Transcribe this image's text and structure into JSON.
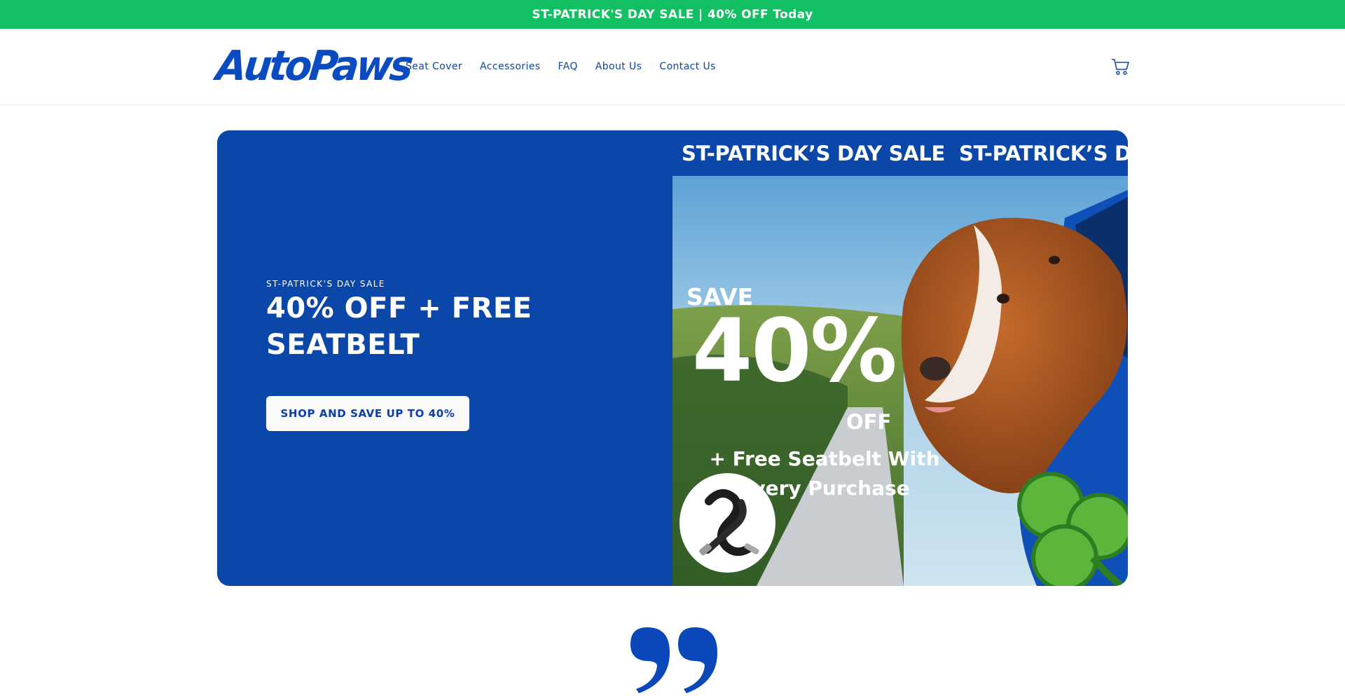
{
  "announcement": {
    "text": "ST-PATRICK'S DAY SALE | 40% OFF Today",
    "bg": "#12bf62"
  },
  "header": {
    "logo_text": "AutoPaws",
    "nav": [
      "Seat Cover",
      "Accessories",
      "FAQ",
      "About Us",
      "Contact Us"
    ],
    "cart_icon": "cart-icon"
  },
  "hero": {
    "eyebrow": "ST-PATRICK’S DAY SALE",
    "headline": "40% OFF + FREE SEATBELT",
    "cta_label": "SHOP AND SAVE UP TO 40%",
    "bg": "#0a47a8",
    "marquee": [
      "ST-PATRICK’S DAY SALE",
      "ST-PATRICK’S DAY SALE"
    ],
    "promo": {
      "save": "SAVE",
      "percent": "40%",
      "off": "OFF",
      "free_line": "+ Free Seatbelt With Every Purchase"
    },
    "photo_icons": [
      "dog-photo",
      "seatbelt-product-icon",
      "shamrock-icon"
    ]
  },
  "testimonial": {
    "icon": "quote-icon"
  }
}
